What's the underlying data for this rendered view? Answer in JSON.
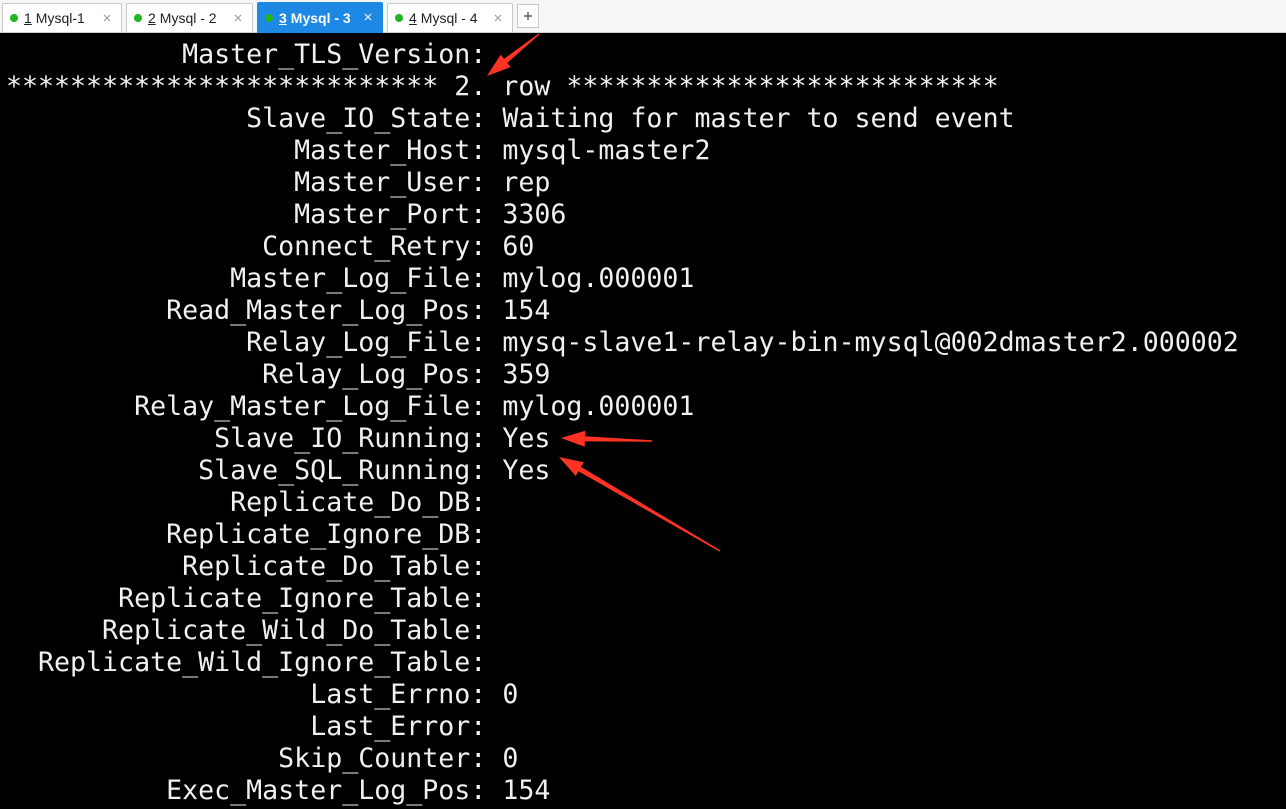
{
  "window": {
    "tabs": [
      {
        "number": "1",
        "title": "Mysql-1",
        "active": false,
        "status_icon": "connected-status-icon",
        "close_icon": "close-icon"
      },
      {
        "number": "2",
        "title": "Mysql - 2",
        "active": false,
        "status_icon": "connected-status-icon",
        "close_icon": "close-icon"
      },
      {
        "number": "3",
        "title": "Mysql - 3",
        "active": true,
        "status_icon": "connected-status-icon",
        "close_icon": "close-icon"
      },
      {
        "number": "4",
        "title": "Mysql - 4",
        "active": false,
        "status_icon": "connected-status-icon",
        "close_icon": "close-icon"
      }
    ],
    "new_tab_icon": "plus-icon"
  },
  "terminal": {
    "lines": [
      {
        "label": "Master_TLS_Version:"
      },
      {
        "separator": "*************************** 2. row ***************************"
      },
      {
        "label": "Slave_IO_State:",
        "value": "Waiting for master to send event"
      },
      {
        "label": "Master_Host:",
        "value": "mysql-master2"
      },
      {
        "label": "Master_User:",
        "value": "rep"
      },
      {
        "label": "Master_Port:",
        "value": "3306"
      },
      {
        "label": "Connect_Retry:",
        "value": "60"
      },
      {
        "label": "Master_Log_File:",
        "value": "mylog.000001"
      },
      {
        "label": "Read_Master_Log_Pos:",
        "value": "154"
      },
      {
        "label": "Relay_Log_File:",
        "value": "mysq-slave1-relay-bin-mysql@002dmaster2.000002"
      },
      {
        "label": "Relay_Log_Pos:",
        "value": "359"
      },
      {
        "label": "Relay_Master_Log_File:",
        "value": "mylog.000001"
      },
      {
        "label": "Slave_IO_Running:",
        "value": "Yes"
      },
      {
        "label": "Slave_SQL_Running:",
        "value": "Yes"
      },
      {
        "label": "Replicate_Do_DB:"
      },
      {
        "label": "Replicate_Ignore_DB:"
      },
      {
        "label": "Replicate_Do_Table:"
      },
      {
        "label": "Replicate_Ignore_Table:"
      },
      {
        "label": "Replicate_Wild_Do_Table:"
      },
      {
        "label": "Replicate_Wild_Ignore_Table:"
      },
      {
        "label": "Last_Errno:",
        "value": "0"
      },
      {
        "label": "Last_Error:"
      },
      {
        "label": "Skip_Counter:",
        "value": "0"
      },
      {
        "label": "Exec_Master_Log_Pos:",
        "value": "154"
      }
    ]
  },
  "annotations": {
    "arrow_icon": "red-arrow-icon"
  },
  "colors": {
    "tab_active_bg": "#1e88e5",
    "status_connected": "#21b521",
    "terminal_bg": "#000000",
    "terminal_fg": "#f0f0f0",
    "annotation_arrow": "#ff3324"
  }
}
